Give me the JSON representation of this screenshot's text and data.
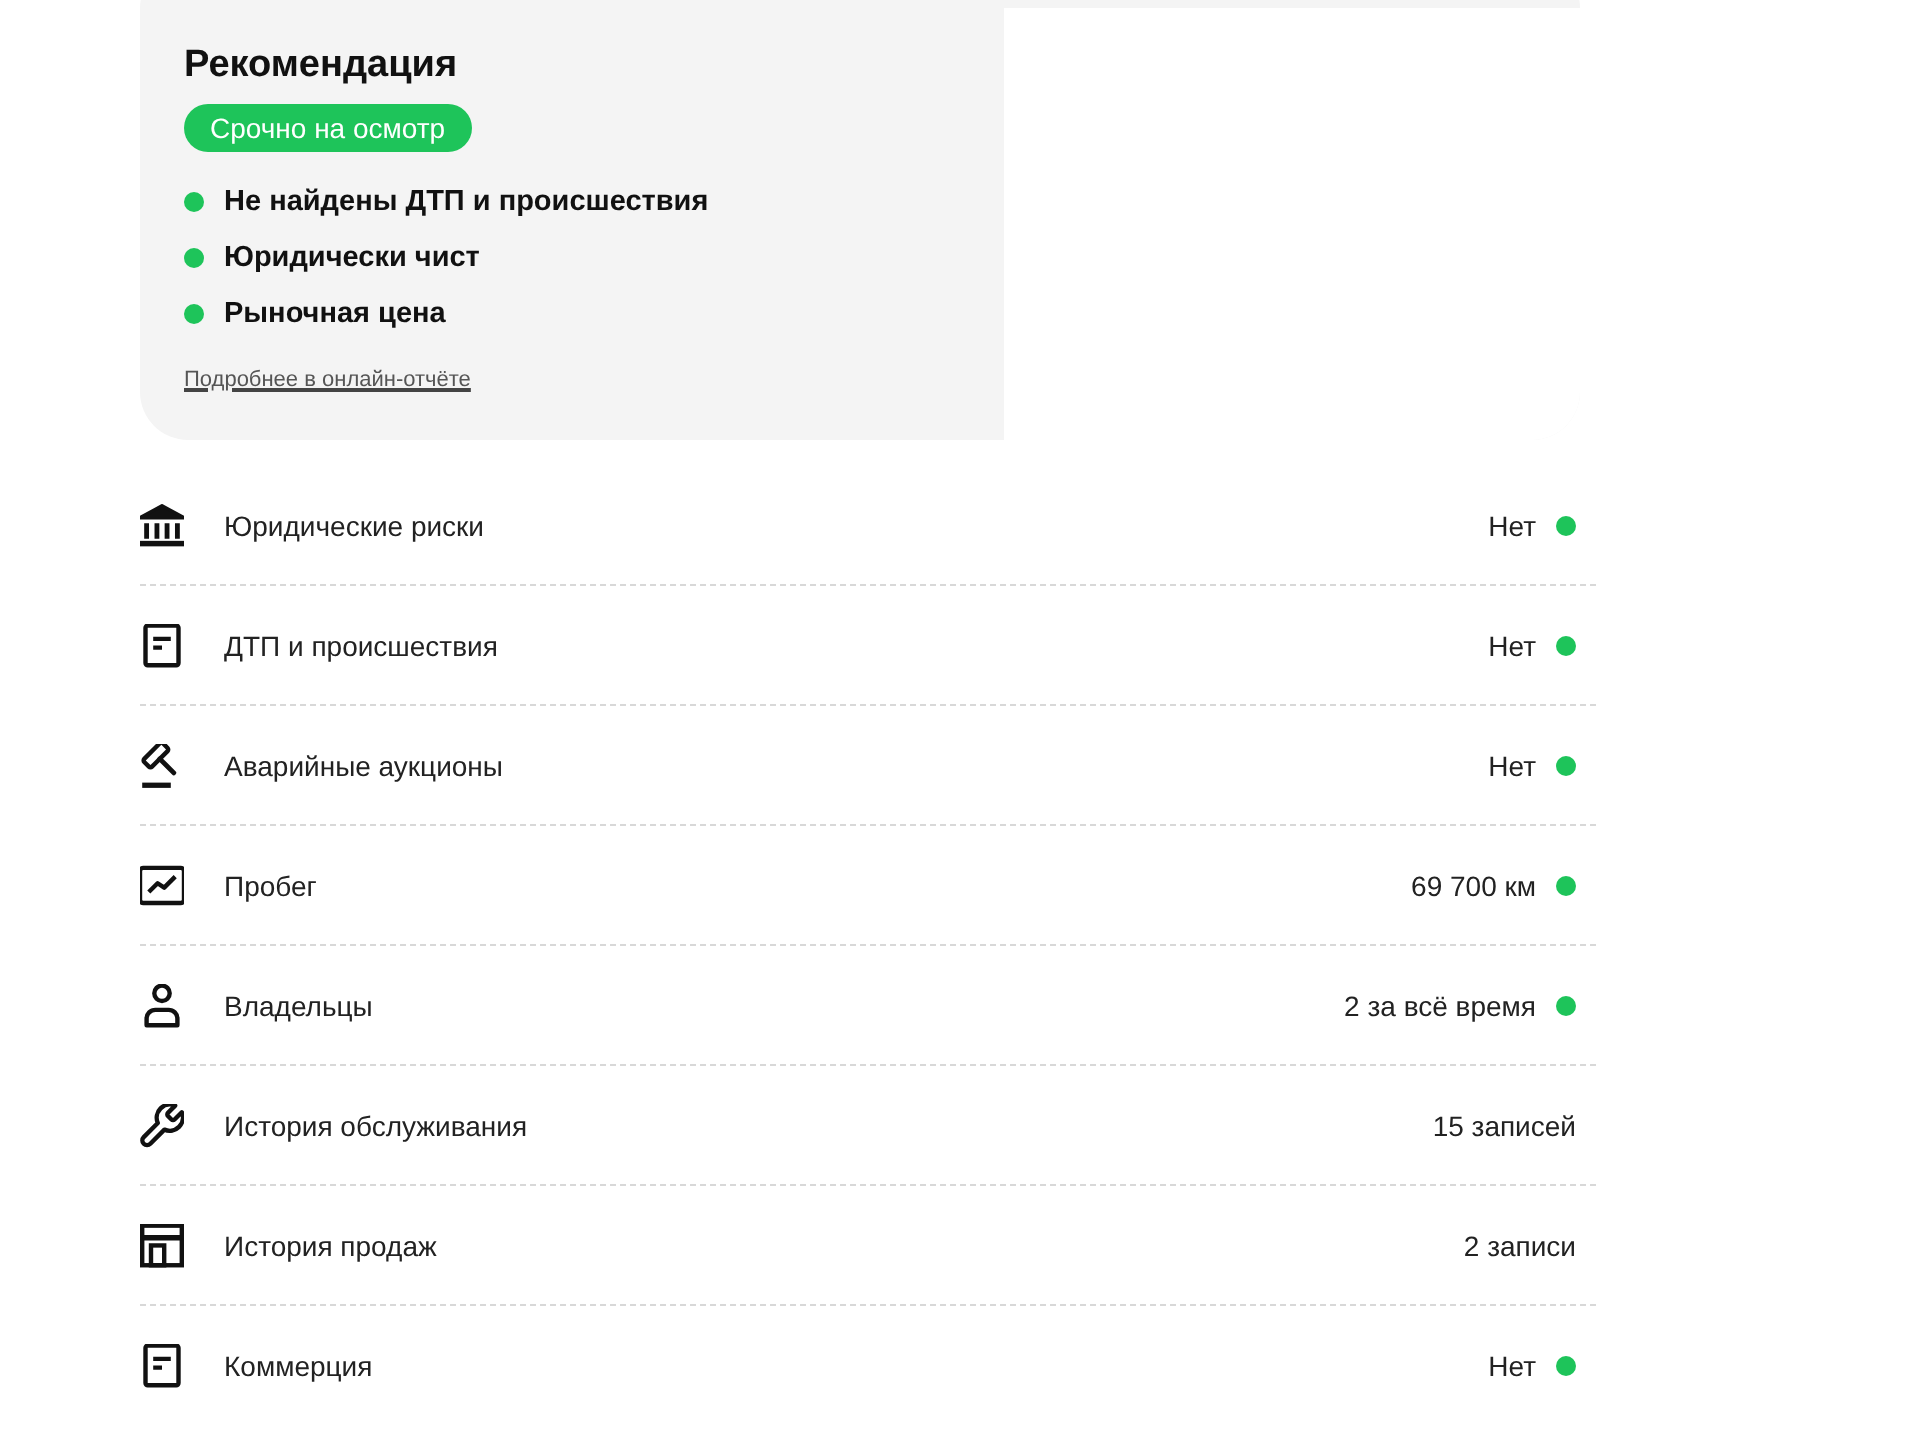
{
  "recommendation": {
    "title": "Рекомендация",
    "badge": "Срочно на осмотр",
    "points": [
      "Не найдены ДТП и происшествия",
      "Юридически чист",
      "Рыночная цена"
    ],
    "link": "Подробнее в онлайн-отчёте"
  },
  "rows": [
    {
      "kind": "bank",
      "label": "Юридические риски",
      "value": "Нет",
      "status_dot": true
    },
    {
      "kind": "document",
      "label": "ДТП и происшествия",
      "value": "Нет",
      "status_dot": true
    },
    {
      "kind": "gavel",
      "label": "Аварийные аукционы",
      "value": "Нет",
      "status_dot": true
    },
    {
      "kind": "chart",
      "label": "Пробег",
      "value": "69 700 км",
      "status_dot": true
    },
    {
      "kind": "person",
      "label": "Владельцы",
      "value": "2 за всё время",
      "status_dot": true
    },
    {
      "kind": "wrench",
      "label": "История обслуживания",
      "value": "15 записей",
      "status_dot": false
    },
    {
      "kind": "shop",
      "label": "История продаж",
      "value": "2 записи",
      "status_dot": false
    },
    {
      "kind": "document",
      "label": "Коммерция",
      "value": "Нет",
      "status_dot": true
    }
  ]
}
